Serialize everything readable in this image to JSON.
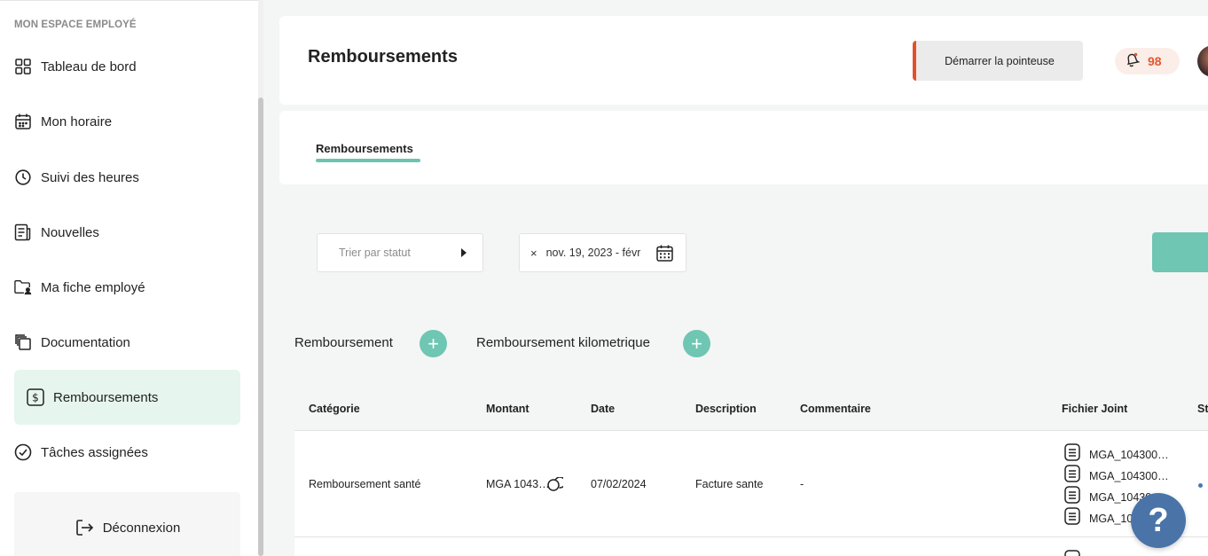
{
  "sidebar": {
    "title": "MON ESPACE EMPLOYÉ",
    "items": [
      {
        "label": "Tableau de bord",
        "icon": "grid-icon"
      },
      {
        "label": "Mon horaire",
        "icon": "calendar-icon"
      },
      {
        "label": "Suivi des heures",
        "icon": "clock-icon"
      },
      {
        "label": "Nouvelles",
        "icon": "news-icon"
      },
      {
        "label": "Ma fiche employé",
        "icon": "user-folder-icon"
      },
      {
        "label": "Documentation",
        "icon": "documents-icon"
      },
      {
        "label": "Remboursements",
        "icon": "dollar-icon",
        "active": true
      },
      {
        "label": "Tâches assignées",
        "icon": "check-circle-icon"
      }
    ],
    "logout": "Déconnexion"
  },
  "header": {
    "title": "Remboursements",
    "clock_button": "Démarrer la pointeuse",
    "notifications_count": "98"
  },
  "tabs": [
    {
      "label": "Remboursements",
      "active": true
    }
  ],
  "filters": {
    "status_placeholder": "Trier par statut",
    "date_clear": "×",
    "date_range": "nov. 19, 2023 - févr"
  },
  "add_actions": [
    {
      "label": "Remboursement"
    },
    {
      "label": "Remboursement kilometrique"
    }
  ],
  "table": {
    "columns": [
      "Catégorie",
      "Montant",
      "Date",
      "Description",
      "Commentaire",
      "Fichier Joint",
      "St"
    ],
    "rows": [
      {
        "category": "Remboursement santé",
        "amount": "MGA 1043…",
        "date": "07/02/2024",
        "description": "Facture sante",
        "comment": "-",
        "files": [
          "MGA_104300…",
          "MGA_104300…",
          "MGA_10430…",
          "MGA_10430…"
        ]
      }
    ]
  },
  "colors": {
    "accent": "#6ec6b3",
    "active_bg": "#e6f5ee",
    "alert": "#e4502b",
    "help": "#4a74a8"
  },
  "help_label": "?"
}
